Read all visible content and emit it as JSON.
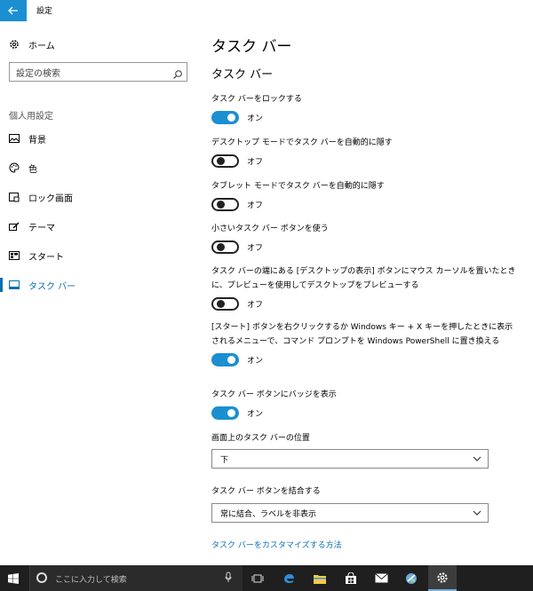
{
  "window": {
    "title": "設定"
  },
  "sidebar": {
    "home_label": "ホーム",
    "search_placeholder": "設定の検索",
    "section_label": "個人用設定",
    "items": [
      {
        "label": "背景",
        "icon": "picture-icon"
      },
      {
        "label": "色",
        "icon": "palette-icon"
      },
      {
        "label": "ロック画面",
        "icon": "lock-screen-icon"
      },
      {
        "label": "テーマ",
        "icon": "theme-brush-icon"
      },
      {
        "label": "スタート",
        "icon": "start-tiles-icon"
      },
      {
        "label": "タスク バー",
        "icon": "taskbar-icon",
        "active": true
      }
    ]
  },
  "main": {
    "page_title": "タスク バー",
    "section_title": "タスク バー",
    "settings": [
      {
        "label": "タスク バーをロックする",
        "state": "オン",
        "on": true
      },
      {
        "label": "デスクトップ モードでタスク バーを自動的に隠す",
        "state": "オフ",
        "on": false
      },
      {
        "label": "タブレット モードでタスク バーを自動的に隠す",
        "state": "オフ",
        "on": false
      },
      {
        "label": "小さいタスク バー ボタンを使う",
        "state": "オフ",
        "on": false
      },
      {
        "label": "タスク バーの端にある [デスクトップの表示] ボタンにマウス カーソルを置いたときに、プレビューを使用してデスクトップをプレビューする",
        "state": "オフ",
        "on": false
      },
      {
        "label": "[スタート] ボタンを右クリックするか Windows キー + X キーを押したときに表示されるメニューで、コマンド プロンプトを Windows PowerShell に置き換える",
        "state": "オン",
        "on": true
      },
      {
        "label": "タスク バー ボタンにバッジを表示",
        "state": "オン",
        "on": true
      }
    ],
    "position": {
      "label": "画面上のタスク バーの位置",
      "value": "下"
    },
    "combine": {
      "label": "タスク バー ボタンを結合する",
      "value": "常に結合、ラベルを非表示"
    },
    "link": "タスク バーをカスタマイズする方法"
  },
  "taskbar": {
    "search_placeholder": "ここに入力して検索",
    "apps": [
      "task-view-icon",
      "edge-icon",
      "file-explorer-icon",
      "store-icon",
      "mail-icon",
      "app-icon",
      "settings-gear-icon"
    ]
  },
  "colors": {
    "accent": "#1b8fd2",
    "link": "#0a6fb0",
    "taskbar": "#1f1f1f"
  }
}
